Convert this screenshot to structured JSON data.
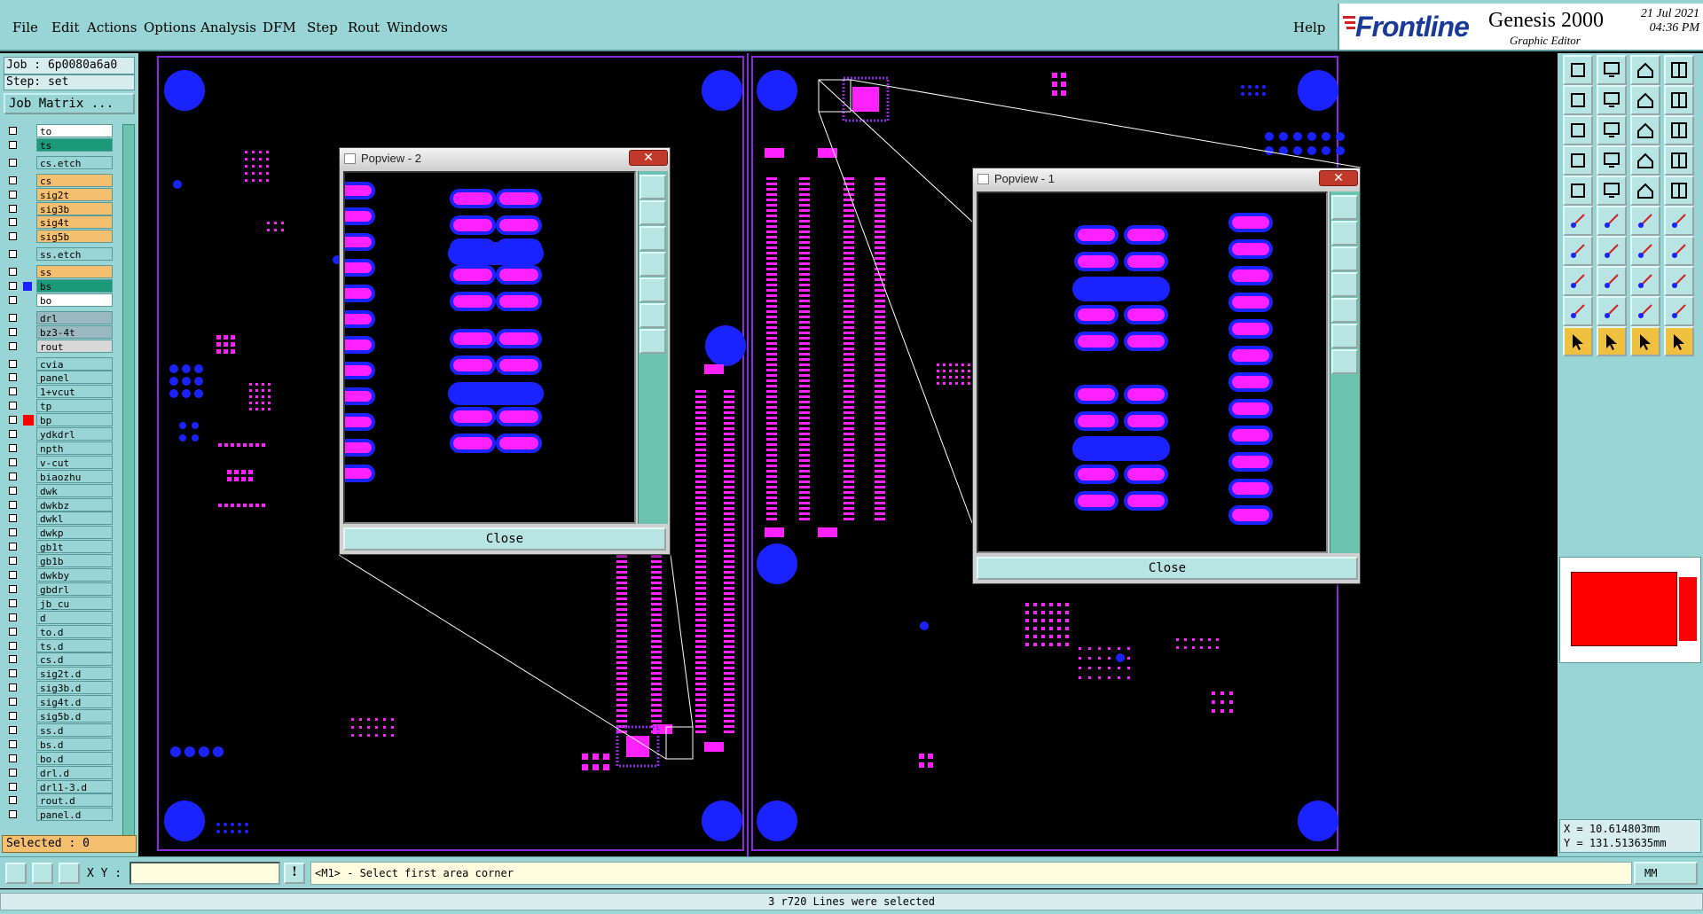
{
  "menu": {
    "items": [
      "File",
      "Edit",
      "Actions",
      "Options",
      "Analysis",
      "DFM",
      "Step",
      "Rout",
      "Windows"
    ],
    "help": "Help"
  },
  "logo": {
    "brand": "Frontline",
    "product": "Genesis 2000",
    "subtitle": "Graphic Editor",
    "date": "21 Jul 2021",
    "time": "04:36 PM"
  },
  "job": {
    "job_label": "Job : 6p0080a6a0",
    "step_label": "Step: set",
    "matrix_button": "Job Matrix ..."
  },
  "layers": [
    {
      "name": "to",
      "color": "#ffffff"
    },
    {
      "name": "ts",
      "color": "#1a9a7a"
    },
    {
      "name": "cs.etch",
      "color": "#9ad5d5"
    },
    {
      "name": "cs",
      "color": "#f4c070"
    },
    {
      "name": "sig2t",
      "color": "#f4c070"
    },
    {
      "name": "sig3b",
      "color": "#f4c070"
    },
    {
      "name": "sig4t",
      "color": "#f4c070"
    },
    {
      "name": "sig5b",
      "color": "#f4c070"
    },
    {
      "name": "ss.etch",
      "color": "#9ad5d5"
    },
    {
      "name": "ss",
      "color": "#f4c070"
    },
    {
      "name": "bs",
      "color": "#1a9a7a"
    },
    {
      "name": "bo",
      "color": "#ffffff"
    },
    {
      "name": "drl",
      "color": "#9ab8c0"
    },
    {
      "name": "bz3-4t",
      "color": "#9ab8c0"
    },
    {
      "name": "rout",
      "color": "#d8d8d8"
    },
    {
      "name": "cvia",
      "color": "#9ad5d5"
    },
    {
      "name": "panel",
      "color": "#9ad5d5"
    },
    {
      "name": "1+vcut",
      "color": "#9ad5d5"
    },
    {
      "name": "tp",
      "color": "#9ad5d5"
    },
    {
      "name": "bp",
      "color": "#9ad5d5"
    },
    {
      "name": "ydkdrl",
      "color": "#9ad5d5"
    },
    {
      "name": "npth",
      "color": "#9ad5d5"
    },
    {
      "name": "v-cut",
      "color": "#9ad5d5"
    },
    {
      "name": "biaozhu",
      "color": "#9ad5d5"
    },
    {
      "name": "dwk",
      "color": "#9ad5d5"
    },
    {
      "name": "dwkbz",
      "color": "#9ad5d5"
    },
    {
      "name": "dwkl",
      "color": "#9ad5d5"
    },
    {
      "name": "dwkp",
      "color": "#9ad5d5"
    },
    {
      "name": "gb1t",
      "color": "#9ad5d5"
    },
    {
      "name": "gb1b",
      "color": "#9ad5d5"
    },
    {
      "name": "dwkby",
      "color": "#9ad5d5"
    },
    {
      "name": "gbdrl",
      "color": "#9ad5d5"
    },
    {
      "name": "jb_cu",
      "color": "#9ad5d5"
    },
    {
      "name": "d",
      "color": "#9ad5d5"
    },
    {
      "name": "to.d",
      "color": "#9ad5d5"
    },
    {
      "name": "ts.d",
      "color": "#9ad5d5"
    },
    {
      "name": "cs.d",
      "color": "#9ad5d5"
    },
    {
      "name": "sig2t.d",
      "color": "#9ad5d5"
    },
    {
      "name": "sig3b.d",
      "color": "#9ad5d5"
    },
    {
      "name": "sig4t.d",
      "color": "#9ad5d5"
    },
    {
      "name": "sig5b.d",
      "color": "#9ad5d5"
    },
    {
      "name": "ss.d",
      "color": "#9ad5d5"
    },
    {
      "name": "bs.d",
      "color": "#9ad5d5"
    },
    {
      "name": "bo.d",
      "color": "#9ad5d5"
    },
    {
      "name": "drl.d",
      "color": "#9ad5d5"
    },
    {
      "name": "drl1-3.d",
      "color": "#9ad5d5"
    },
    {
      "name": "rout.d",
      "color": "#9ad5d5"
    },
    {
      "name": "panel.d",
      "color": "#9ad5d5"
    }
  ],
  "selected_label": "Selected : 0",
  "popview2": {
    "title": "Popview - 2",
    "close": "Close",
    "x_glyph": "✕"
  },
  "popview1": {
    "title": "Popview - 1",
    "close": "Close",
    "x_glyph": "✕"
  },
  "coords": {
    "x": "X = 10.614803mm",
    "y": "Y = 131.513635mm"
  },
  "command": {
    "xy_label": "X Y :",
    "xy_value": "",
    "prompt": "<M1> - Select first area corner",
    "units": "MM"
  },
  "status": "3 r720 Lines were selected",
  "colors": {
    "pad_magenta": "#ff22ff",
    "pad_outline_blue": "#1a22ff",
    "board_outline": "#8a2ae0",
    "accent_teal": "#9ad5d5"
  }
}
